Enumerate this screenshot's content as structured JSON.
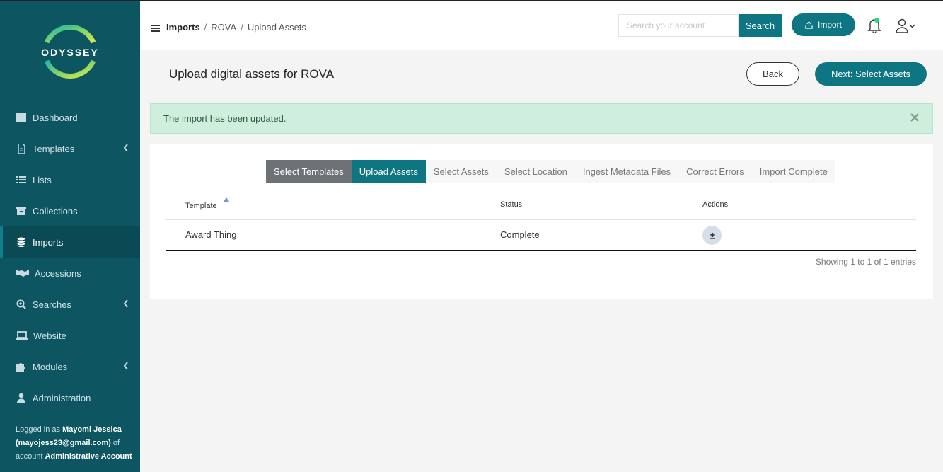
{
  "app": {
    "logo_text": "ODYSSEY"
  },
  "sidebar": {
    "items": [
      {
        "label": "Dashboard",
        "icon": "dashboard-icon",
        "has_submenu": false,
        "active": false
      },
      {
        "label": "Templates",
        "icon": "file-icon",
        "has_submenu": true,
        "active": false
      },
      {
        "label": "Lists",
        "icon": "list-icon",
        "has_submenu": false,
        "active": false
      },
      {
        "label": "Collections",
        "icon": "archive-icon",
        "has_submenu": false,
        "active": false
      },
      {
        "label": "Imports",
        "icon": "database-icon",
        "has_submenu": false,
        "active": true
      },
      {
        "label": "Accessions",
        "icon": "handshake-icon",
        "has_submenu": false,
        "active": false
      },
      {
        "label": "Searches",
        "icon": "search-plus-icon",
        "has_submenu": true,
        "active": false
      },
      {
        "label": "Website",
        "icon": "laptop-icon",
        "has_submenu": false,
        "active": false
      },
      {
        "label": "Modules",
        "icon": "puzzle-icon",
        "has_submenu": true,
        "active": false
      },
      {
        "label": "Administration",
        "icon": "user-icon",
        "has_submenu": false,
        "active": false
      }
    ],
    "logged_in": {
      "prefix": "Logged in as",
      "name": "Mayomi Jessica",
      "email": "(mayojess23@gmail.com)",
      "of_account": "of account",
      "account": "Administrative Account"
    }
  },
  "header": {
    "breadcrumb": [
      "Imports",
      "ROVA",
      "Upload Assets"
    ],
    "search": {
      "placeholder": "Search your account",
      "value": "",
      "button_label": "Search"
    },
    "import_label": "Import"
  },
  "page": {
    "title": "Upload digital assets for ROVA",
    "back_label": "Back",
    "next_label": "Next: Select Assets"
  },
  "alert": {
    "message": "The import has been updated."
  },
  "wizard": {
    "steps": [
      {
        "label": "Select Templates",
        "state": "done"
      },
      {
        "label": "Upload Assets",
        "state": "current"
      },
      {
        "label": "Select Assets",
        "state": "pending"
      },
      {
        "label": "Select Location",
        "state": "pending"
      },
      {
        "label": "Ingest Metadata Files",
        "state": "pending"
      },
      {
        "label": "Correct Errors",
        "state": "pending"
      },
      {
        "label": "Import Complete",
        "state": "pending"
      }
    ]
  },
  "table": {
    "columns": [
      "Template",
      "Status",
      "Actions"
    ],
    "rows": [
      {
        "template": "Award Thing",
        "status": "Complete",
        "action_icon": "upload-icon"
      }
    ],
    "footer": "Showing 1 to 1 of 1 entries"
  },
  "colors": {
    "sidebar_bg": "#0c5561",
    "accent": "#0d7682",
    "alert_bg": "#cfeedd",
    "step_done": "#6d7276"
  }
}
